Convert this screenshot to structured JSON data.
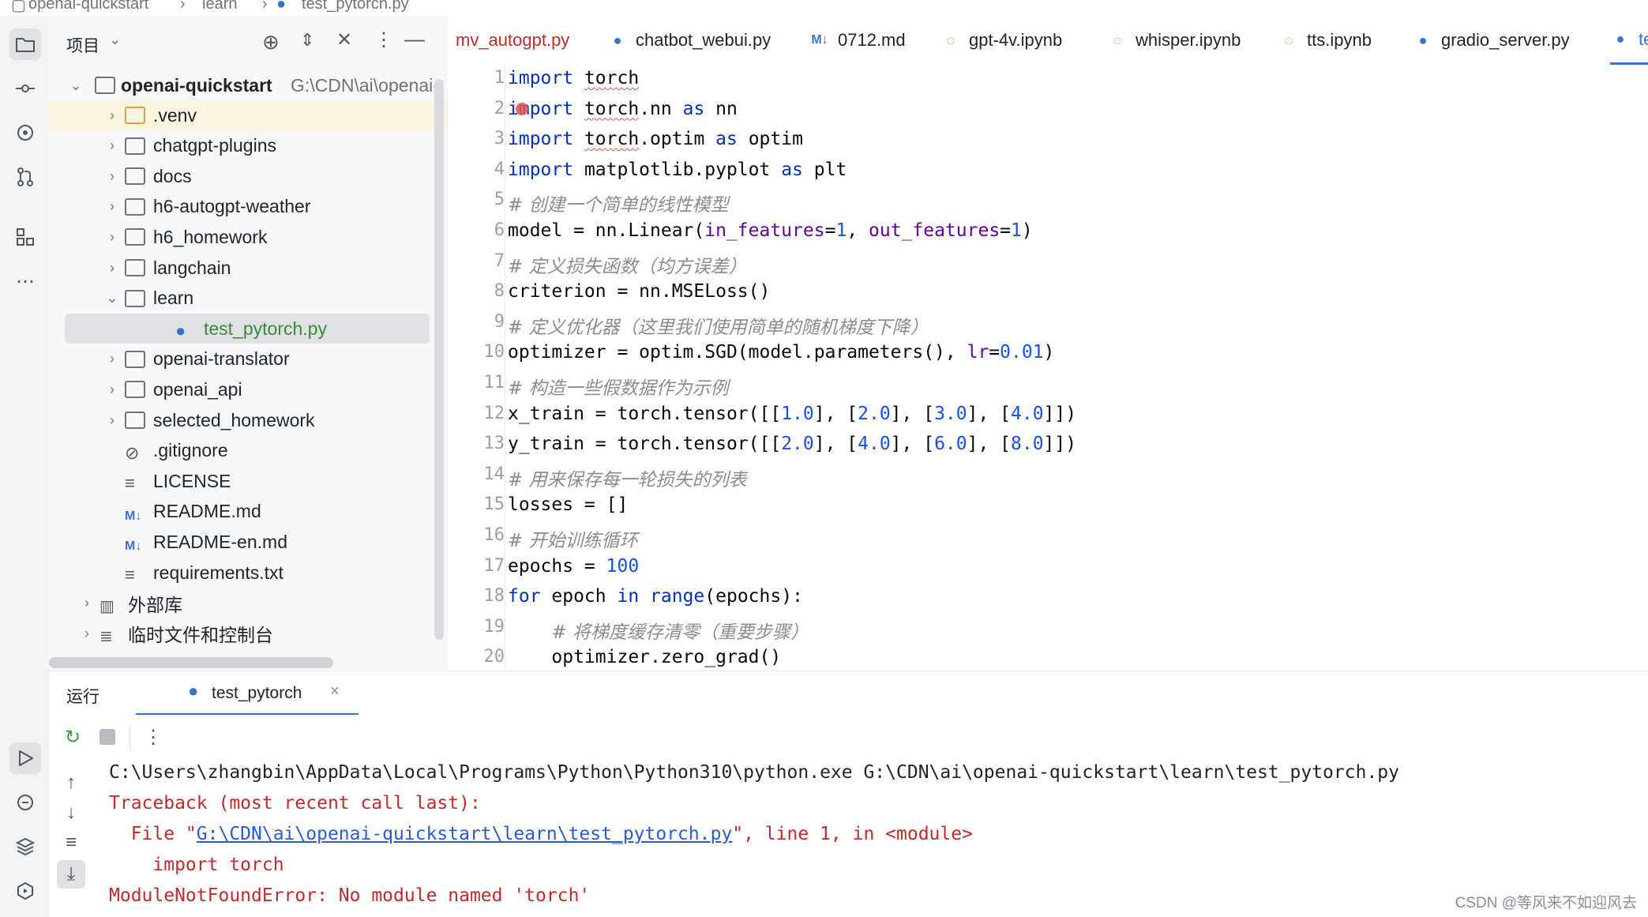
{
  "breadcrumb": [
    "openai-quickstart",
    "learn",
    "test_pytorch.py"
  ],
  "project_panel": {
    "title": "项目",
    "root": {
      "name": "openai-quickstart",
      "path": "G:\\CDN\\ai\\openai-"
    },
    "items": [
      {
        "label": ".venv",
        "kind": "folder",
        "depth": 1,
        "state": "collapsed"
      },
      {
        "label": "chatgpt-plugins",
        "kind": "folder",
        "depth": 1,
        "state": "collapsed"
      },
      {
        "label": "docs",
        "kind": "folder",
        "depth": 1,
        "state": "collapsed"
      },
      {
        "label": "h6-autogpt-weather",
        "kind": "folder",
        "depth": 1,
        "state": "collapsed"
      },
      {
        "label": "h6_homework",
        "kind": "folder",
        "depth": 1,
        "state": "collapsed"
      },
      {
        "label": "langchain",
        "kind": "folder",
        "depth": 1,
        "state": "collapsed"
      },
      {
        "label": "learn",
        "kind": "folder",
        "depth": 1,
        "state": "expanded"
      },
      {
        "label": "test_pytorch.py",
        "kind": "python",
        "depth": 2,
        "state": "selected"
      },
      {
        "label": "openai-translator",
        "kind": "folder",
        "depth": 1,
        "state": "collapsed"
      },
      {
        "label": "openai_api",
        "kind": "folder",
        "depth": 1,
        "state": "collapsed"
      },
      {
        "label": "selected_homework",
        "kind": "folder",
        "depth": 1,
        "state": "collapsed"
      },
      {
        "label": ".gitignore",
        "kind": "ignore",
        "depth": 1
      },
      {
        "label": "LICENSE",
        "kind": "text",
        "depth": 1
      },
      {
        "label": "README.md",
        "kind": "markdown",
        "depth": 1
      },
      {
        "label": "README-en.md",
        "kind": "markdown",
        "depth": 1
      },
      {
        "label": "requirements.txt",
        "kind": "text",
        "depth": 1
      },
      {
        "label": "外部库",
        "kind": "library",
        "depth": 0,
        "state": "collapsed"
      },
      {
        "label": "临时文件和控制台",
        "kind": "scratch",
        "depth": 0,
        "state": "collapsed"
      }
    ]
  },
  "tabs": [
    {
      "label": "mv_autogpt.py",
      "kind": "python",
      "state": "error"
    },
    {
      "label": "chatbot_webui.py",
      "kind": "python"
    },
    {
      "label": "0712.md",
      "kind": "markdown"
    },
    {
      "label": "gpt-4v.ipynb",
      "kind": "notebook"
    },
    {
      "label": "whisper.ipynb",
      "kind": "notebook"
    },
    {
      "label": "tts.ipynb",
      "kind": "notebook"
    },
    {
      "label": "gradio_server.py",
      "kind": "python"
    },
    {
      "label": "te",
      "kind": "python",
      "state": "active"
    }
  ],
  "editor": {
    "lines": [
      "import torch",
      "import torch.nn as nn",
      "import torch.optim as optim",
      "import matplotlib.pyplot as plt",
      "# 创建一个简单的线性模型",
      "model = nn.Linear(in_features=1, out_features=1)",
      "# 定义损失函数（均方误差）",
      "criterion = nn.MSELoss()",
      "# 定义优化器（这里我们使用简单的随机梯度下降）",
      "optimizer = optim.SGD(model.parameters(), lr=0.01)",
      "# 构造一些假数据作为示例",
      "x_train = torch.tensor([[1.0], [2.0], [3.0], [4.0]])",
      "y_train = torch.tensor([[2.0], [4.0], [6.0], [8.0]])",
      "# 用来保存每一轮损失的列表",
      "losses = []",
      "# 开始训练循环",
      "epochs = 100",
      "for epoch in range(epochs):",
      "    # 将梯度缓存清零（重要步骤）",
      "    optimizer.zero_grad()"
    ]
  },
  "run_panel": {
    "title": "运行",
    "tab_label": "test_pytorch",
    "console": [
      {
        "type": "cmd",
        "text": "C:\\Users\\zhangbin\\AppData\\Local\\Programs\\Python\\Python310\\python.exe G:\\CDN\\ai\\openai-quickstart\\learn\\test_pytorch.py"
      },
      {
        "type": "err",
        "text": "Traceback (most recent call last):"
      },
      {
        "type": "err-file",
        "pre": "  File \"",
        "link": "G:\\CDN\\ai\\openai-quickstart\\learn\\test_pytorch.py",
        "post": "\", line 1, in <module>"
      },
      {
        "type": "err",
        "text": "    import torch"
      },
      {
        "type": "err",
        "text": "ModuleNotFoundError: No module named 'torch'"
      }
    ]
  },
  "watermark": "CSDN @等风来不如迎风去",
  "colors": {
    "keyword": "#0033b3",
    "number": "#1750eb",
    "param": "#660099",
    "comment": "#8c8c8c",
    "error": "#c02c2c",
    "link": "#2a5bd7"
  }
}
